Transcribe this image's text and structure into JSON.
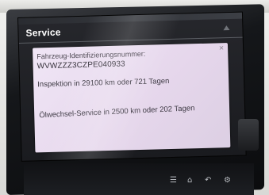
{
  "screen": {
    "title": "Service"
  },
  "message": {
    "vin_label": "Fahrzeug-Identifizierungsnummer:",
    "vin_value": "WVWZZZ3CZPE040933",
    "inspection": "Inspektion in 29100 km oder 721 Tagen",
    "oil_service": "Ölwechsel-Service in 2500 km oder 202 Tagen"
  },
  "colors": {
    "screen_bg": "#1e1f23",
    "dialog_bg": "#eadff0",
    "title_text": "#ffffff",
    "body_text": "#3a3640"
  },
  "icons": [
    "close-icon",
    "scroll-up-icon",
    "menu-button-icon",
    "home-button-icon",
    "back-button-icon",
    "settings-button-icon"
  ]
}
